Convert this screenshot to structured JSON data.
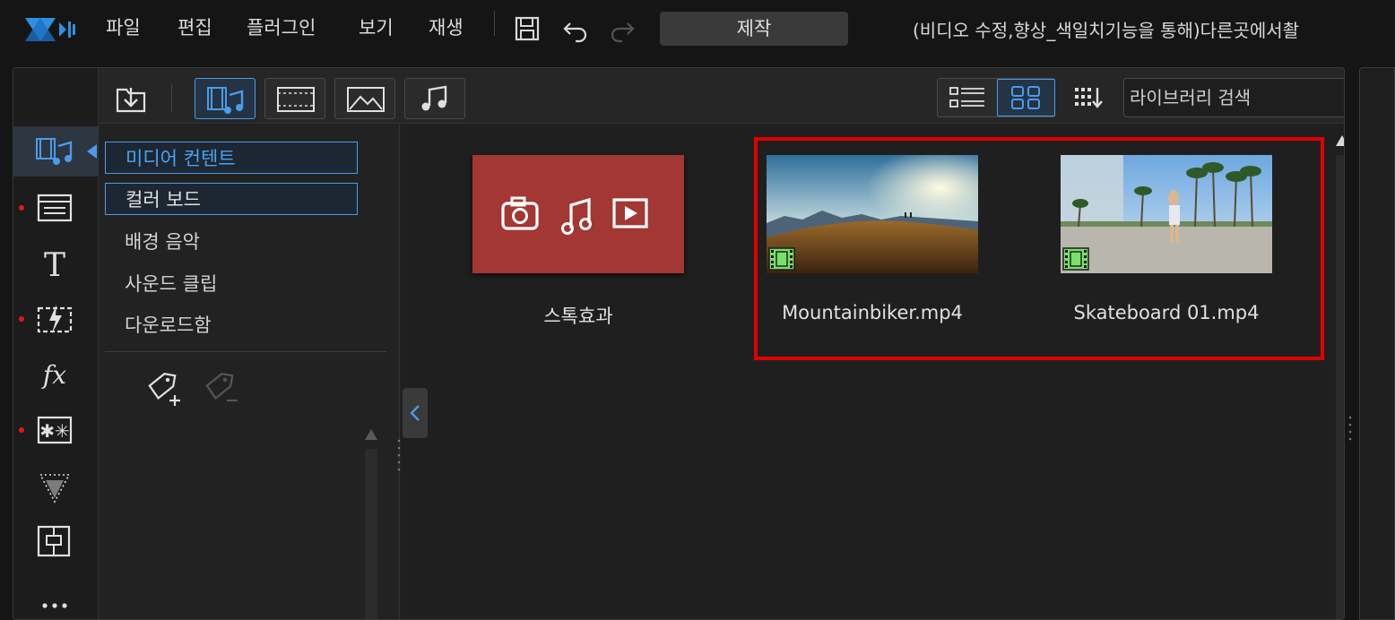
{
  "app": {
    "menu": [
      "파일",
      "편집",
      "플러그인",
      "보기",
      "재생"
    ],
    "produce_label": "제작",
    "project_title": "(비디오 수정,향상_색일치기능을 통해)다른곳에서촬"
  },
  "library": {
    "search_placeholder": "라이브러리 검색",
    "categories": [
      "미디어 컨텐트",
      "컬러 보드",
      "배경 음악",
      "사운드 클립",
      "다운로드함"
    ],
    "items": [
      {
        "label": "스톡효과",
        "type": "stock"
      },
      {
        "label": "Mountainbiker.mp4",
        "type": "video"
      },
      {
        "label": "Skateboard 01.mp4",
        "type": "video"
      }
    ]
  },
  "colors": {
    "accent": "#4a9bea",
    "stock_tile": "#a23733",
    "highlight": "#e00000",
    "notify_dot": "#e01818"
  },
  "icons": {
    "rail": [
      "media-room-icon",
      "titles-room-icon",
      "text-icon",
      "transition-icon",
      "fx-icon",
      "particle-icon",
      "fade-icon",
      "pip-icon",
      "more-icon"
    ]
  }
}
